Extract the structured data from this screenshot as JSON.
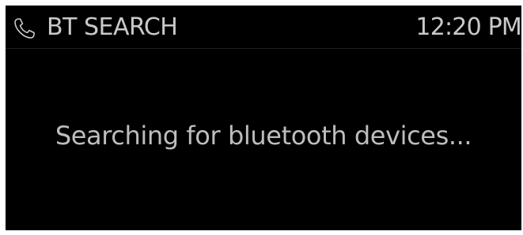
{
  "header": {
    "icon": "phone-handset-icon",
    "title": "BT SEARCH",
    "time": "12:20 PM"
  },
  "main": {
    "status_message": "Searching for bluetooth devices..."
  },
  "colors": {
    "background": "#000000",
    "text": "#c9c9c9"
  }
}
